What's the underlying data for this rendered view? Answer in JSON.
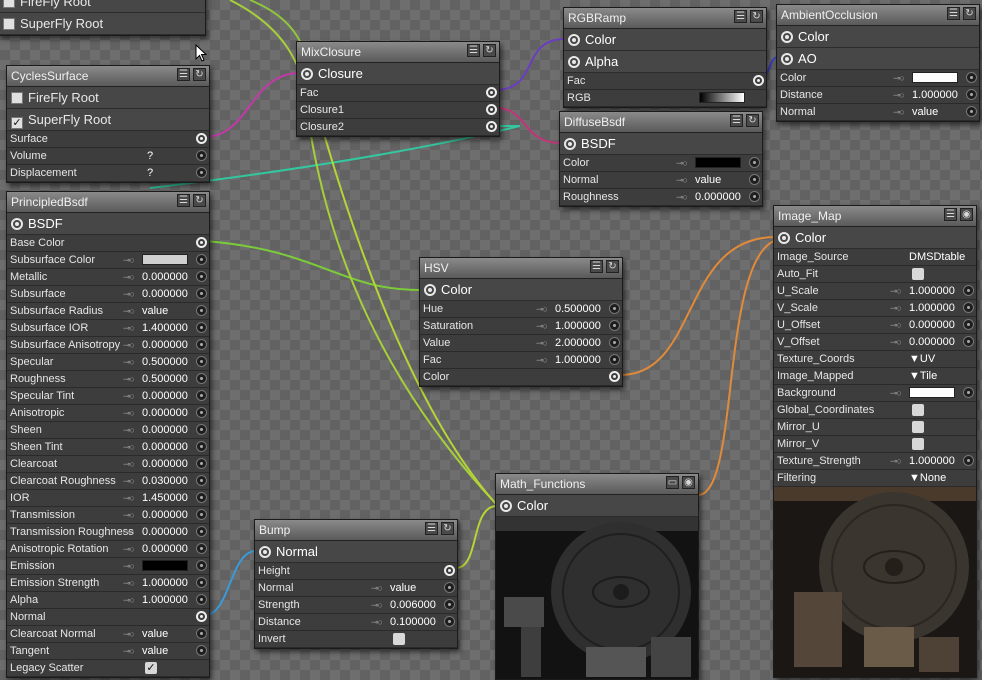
{
  "top_fragment": {
    "items": [
      {
        "label": "FireFly Root",
        "checked": false
      },
      {
        "label": "SuperFly Root",
        "checked": false
      }
    ]
  },
  "cycles_surface": {
    "title": "CyclesSurface",
    "checks": [
      {
        "label": "FireFly Root",
        "checked": false
      },
      {
        "label": "SuperFly Root",
        "checked": true
      }
    ],
    "rows": [
      {
        "label": "Surface",
        "value": "",
        "out": true
      },
      {
        "label": "Volume",
        "value": "?"
      },
      {
        "label": "Displacement",
        "value": "?"
      }
    ]
  },
  "mix_closure": {
    "title": "MixClosure",
    "output": "Closure",
    "rows": [
      {
        "label": "Fac"
      },
      {
        "label": "Closure1"
      },
      {
        "label": "Closure2"
      }
    ]
  },
  "rgb_ramp": {
    "title": "RGBRamp",
    "outputs": [
      "Color",
      "Alpha"
    ],
    "rows": [
      {
        "label": "Fac"
      },
      {
        "label": "RGB"
      }
    ]
  },
  "ambient_occlusion": {
    "title": "AmbientOcclusion",
    "outputs": [
      "Color",
      "AO"
    ],
    "rows": [
      {
        "label": "Color",
        "swatch": "#ffffff"
      },
      {
        "label": "Distance",
        "value": "1.000000"
      },
      {
        "label": "Normal",
        "value": "value"
      }
    ]
  },
  "diffuse_bsdf": {
    "title": "DiffuseBsdf",
    "output": "BSDF",
    "rows": [
      {
        "label": "Color",
        "swatch": "#000000"
      },
      {
        "label": "Normal",
        "value": "value"
      },
      {
        "label": "Roughness",
        "value": "0.000000"
      }
    ]
  },
  "principled_bsdf": {
    "title": "PrincipledBsdf",
    "output": "BSDF",
    "rows": [
      {
        "label": "Base Color",
        "out": true
      },
      {
        "label": "Subsurface Color",
        "swatch": "#d0d0d0"
      },
      {
        "label": "Metallic",
        "value": "0.000000"
      },
      {
        "label": "Subsurface",
        "value": "0.000000"
      },
      {
        "label": "Subsurface Radius",
        "value": "value"
      },
      {
        "label": "Subsurface IOR",
        "value": "1.400000"
      },
      {
        "label": "Subsurface Anisotropy",
        "value": "0.000000"
      },
      {
        "label": "Specular",
        "value": "0.500000"
      },
      {
        "label": "Roughness",
        "value": "0.500000"
      },
      {
        "label": "Specular Tint",
        "value": "0.000000"
      },
      {
        "label": "Anisotropic",
        "value": "0.000000"
      },
      {
        "label": "Sheen",
        "value": "0.000000"
      },
      {
        "label": "Sheen Tint",
        "value": "0.000000"
      },
      {
        "label": "Clearcoat",
        "value": "0.000000"
      },
      {
        "label": "Clearcoat Roughness",
        "value": "0.030000"
      },
      {
        "label": "IOR",
        "value": "1.450000"
      },
      {
        "label": "Transmission",
        "value": "0.000000"
      },
      {
        "label": "Transmission Roughness",
        "value": "0.000000"
      },
      {
        "label": "Anisotropic Rotation",
        "value": "0.000000"
      },
      {
        "label": "Emission",
        "swatch": "#000000"
      },
      {
        "label": "Emission Strength",
        "value": "1.000000"
      },
      {
        "label": "Alpha",
        "value": "1.000000"
      },
      {
        "label": "Normal",
        "out": true
      },
      {
        "label": "Clearcoat Normal",
        "value": "value"
      },
      {
        "label": "Tangent",
        "value": "value"
      },
      {
        "label": "Legacy Scatter",
        "check": true
      }
    ]
  },
  "hsv": {
    "title": "HSV",
    "output": "Color",
    "rows": [
      {
        "label": "Hue",
        "value": "0.500000"
      },
      {
        "label": "Saturation",
        "value": "1.000000"
      },
      {
        "label": "Value",
        "value": "2.000000"
      },
      {
        "label": "Fac",
        "value": "1.000000"
      },
      {
        "label": "Color",
        "out": true
      }
    ]
  },
  "image_map": {
    "title": "Image_Map",
    "output": "Color",
    "rows": [
      {
        "label": "Image_Source",
        "value": "DMSDtable"
      },
      {
        "label": "Auto_Fit",
        "check": false
      },
      {
        "label": "U_Scale",
        "value": "1.000000"
      },
      {
        "label": "V_Scale",
        "value": "1.000000"
      },
      {
        "label": "U_Offset",
        "value": "0.000000"
      },
      {
        "label": "V_Offset",
        "value": "0.000000"
      },
      {
        "label": "Texture_Coords",
        "value": "▼UV"
      },
      {
        "label": "Image_Mapped",
        "value": "▼Tile"
      },
      {
        "label": "Background",
        "swatch": "#ffffff"
      },
      {
        "label": "Global_Coordinates",
        "check": false
      },
      {
        "label": "Mirror_U",
        "check": false
      },
      {
        "label": "Mirror_V",
        "check": false
      },
      {
        "label": "Texture_Strength",
        "value": "1.000000"
      },
      {
        "label": "Filtering",
        "value": "▼None"
      }
    ]
  },
  "math_functions": {
    "title": "Math_Functions",
    "output": "Color"
  },
  "bump": {
    "title": "Bump",
    "output": "Normal",
    "rows": [
      {
        "label": "Height",
        "out": true
      },
      {
        "label": "Normal",
        "value": "value"
      },
      {
        "label": "Strength",
        "value": "0.006000"
      },
      {
        "label": "Distance",
        "value": "0.100000"
      },
      {
        "label": "Invert",
        "check": false
      }
    ]
  },
  "colors": {
    "surface_wire": "#c23aa8",
    "closure_wire": "#6a3ec0",
    "rgb_wire": "#3c3cc8",
    "diffuse_wire": "#c2347a",
    "green_wire": "#9fd33d",
    "teal_wire": "#33c7a0",
    "orange_wire": "#e08a3a",
    "blue_wire": "#3a9ad8"
  }
}
